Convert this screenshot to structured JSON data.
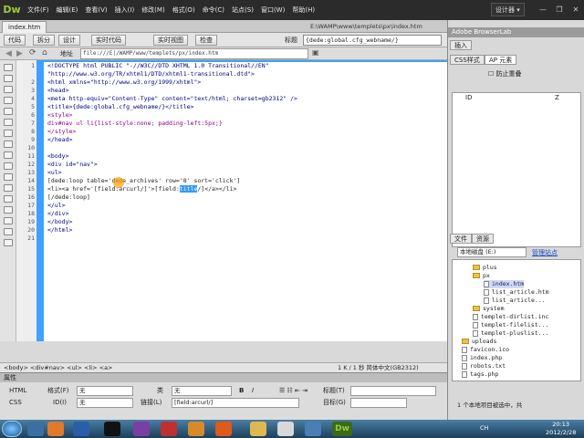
{
  "app": {
    "logo": "Dw",
    "menus": [
      "文件(F)",
      "编辑(E)",
      "查看(V)",
      "插入(I)",
      "修改(M)",
      "格式(O)",
      "命令(C)",
      "站点(S)",
      "窗口(W)",
      "帮助(H)"
    ],
    "workspace": "设计器 ▾"
  },
  "document": {
    "tab": "index.htm",
    "path": "E:\\WAMP\\www\\templets\\px\\index.htm",
    "view_buttons": [
      "代码",
      "拆分",
      "设计",
      "实时代码",
      "实时视图",
      "检查"
    ],
    "title_label": "标题",
    "title_value": "{dede:global.cfg_webname/}",
    "address_label": "地址",
    "address_value": "file:///E|/WAMP/www/templets/px/index.htm"
  },
  "code": {
    "line_numbers": [
      "1",
      "2",
      "3",
      "4",
      "5",
      "6",
      "7",
      "8",
      "9",
      "10",
      "11",
      "12",
      "13",
      "14",
      "15",
      "16",
      "17",
      "18",
      "19",
      "20",
      "21"
    ],
    "lines": [
      "<!DOCTYPE html PUBLIC \"-//W3C//DTD XHTML 1.0 Transitional//EN\"",
      "\"http://www.w3.org/TR/xhtml1/DTD/xhtml1-transitional.dtd\">",
      "<html xmlns=\"http://www.w3.org/1999/xhtml\">",
      "<head>",
      "<meta http-equiv=\"Content-Type\" content=\"text/html; charset=gb2312\" />",
      "<title>{dede:global.cfg_webname/}</title>",
      "<style>",
      "div#nav ul li{list-style:none; padding-left:5px;}",
      "</style>",
      "</head>",
      "",
      "<body>",
      "<div id=\"nav\">",
      "<ul>",
      "[dede:loop table='dede_archives' row='8' sort='click']",
      "<li><a href='[field:arcurl/]'>[field:title/]</a></li>",
      "[/dede:loop]",
      "</ul>",
      "</div>",
      "</body>",
      "</html>"
    ],
    "line16_before": "<li><a href='[field:arcurl/]'>[field:",
    "line16_selected": "title",
    "line16_after": "/]</a></li>"
  },
  "status": {
    "tag_path": "<body> <div#nav> <ul> <li> <a>",
    "info": "1 K / 1 秒  简体中文(GB2312)"
  },
  "properties": {
    "title": "属性",
    "html_label": "HTML",
    "css_label": "CSS",
    "format_label": "格式(F)",
    "format_value": "无",
    "class_label": "类",
    "class_value": "无",
    "id_label": "ID(I)",
    "id_value": "无",
    "link_label": "链接(L)",
    "link_value": "[field:arcurl/]",
    "target_label": "目标(G)",
    "title_label": "标题(T)",
    "bold": "B",
    "italic": "I"
  },
  "right_panel": {
    "header_top": "Adobe BrowserLab",
    "insert_tab": "插入",
    "css_tab": "CSS样式",
    "ap_tab": "AP 元素",
    "prevent_overlap": "防止重叠",
    "ap_col_id": "ID",
    "ap_col_z": "Z",
    "files_tab": "文件",
    "assets_tab": "资源",
    "drive": "本地磁盘 (E:)",
    "manage_sites": "管理站点",
    "tree": [
      {
        "type": "folder",
        "name": "plus",
        "indent": 1
      },
      {
        "type": "folder",
        "name": "px",
        "indent": 1
      },
      {
        "type": "file",
        "name": "index.htm",
        "indent": 2,
        "selected": true
      },
      {
        "type": "file",
        "name": "list_article.htm",
        "indent": 2
      },
      {
        "type": "file",
        "name": "list_article...",
        "indent": 2
      },
      {
        "type": "folder",
        "name": "system",
        "indent": 1
      },
      {
        "type": "file",
        "name": "templet-dirlist.inc",
        "indent": 1
      },
      {
        "type": "file",
        "name": "templet-filelist...",
        "indent": 1
      },
      {
        "type": "file",
        "name": "templet-pluslist...",
        "indent": 1
      },
      {
        "type": "folder",
        "name": "uploads",
        "indent": 0
      },
      {
        "type": "file",
        "name": "favicon.ico",
        "indent": 0
      },
      {
        "type": "file",
        "name": "index.php",
        "indent": 0
      },
      {
        "type": "file",
        "name": "robots.txt",
        "indent": 0
      },
      {
        "type": "file",
        "name": "tags.php",
        "indent": 0
      }
    ],
    "files_status": "1 个本地项目被选中，共"
  },
  "taskbar": {
    "lang": "CH",
    "time": "20:13",
    "date": "2012/2/28",
    "dw_label": "Dw"
  },
  "colors": {
    "accent": "#3fa0ff",
    "logo": "#9ccc3c",
    "selection": "#3399ff"
  }
}
